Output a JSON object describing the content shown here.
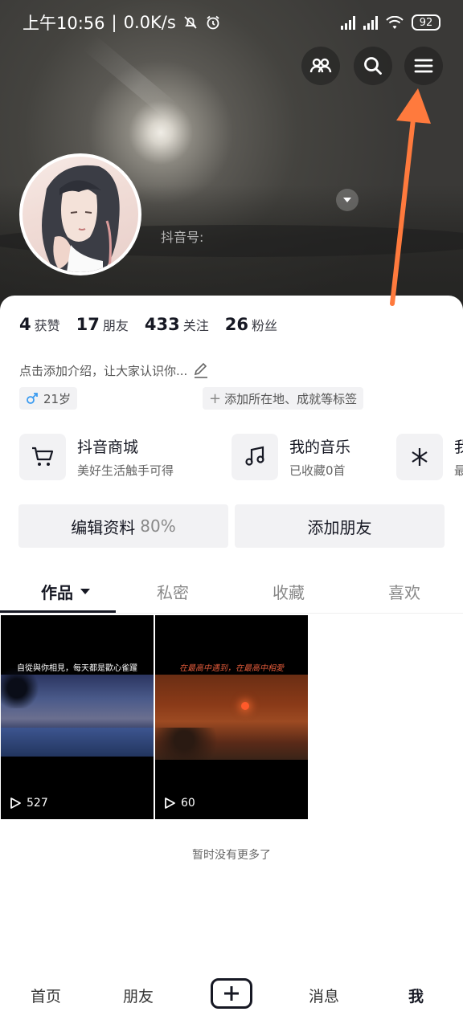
{
  "status_bar": {
    "time": "上午10:56",
    "net_speed": "0.0K/s",
    "battery": "92"
  },
  "header": {
    "douyin_id_label": "抖音号:"
  },
  "stats": [
    {
      "num": "4",
      "label": "获赞"
    },
    {
      "num": "17",
      "label": "朋友"
    },
    {
      "num": "433",
      "label": "关注"
    },
    {
      "num": "26",
      "label": "粉丝"
    }
  ],
  "profile": {
    "intro": "点击添加介绍，让大家认识你...",
    "age": "21岁",
    "add_tags": "添加所在地、成就等标签"
  },
  "features": [
    {
      "title": "抖音商城",
      "sub": "美好生活触手可得"
    },
    {
      "title": "我的音乐",
      "sub": "已收藏0首"
    },
    {
      "title": "我",
      "sub": "最"
    }
  ],
  "actions": {
    "edit": "编辑资料",
    "edit_pct": "80%",
    "add_friend": "添加朋友"
  },
  "tabs": [
    "作品",
    "私密",
    "收藏",
    "喜欢"
  ],
  "videos": [
    {
      "caption": "自從與你相見，每天都是歡心雀躍",
      "plays": "527"
    },
    {
      "caption": "在最高中遇到，在最高中相愛",
      "plays": "60"
    }
  ],
  "no_more": "暂时没有更多了",
  "nav": [
    "首页",
    "朋友",
    "消息",
    "我"
  ],
  "colors": {
    "accent_arrow": "#ff7a3d",
    "text_primary": "#161823"
  }
}
